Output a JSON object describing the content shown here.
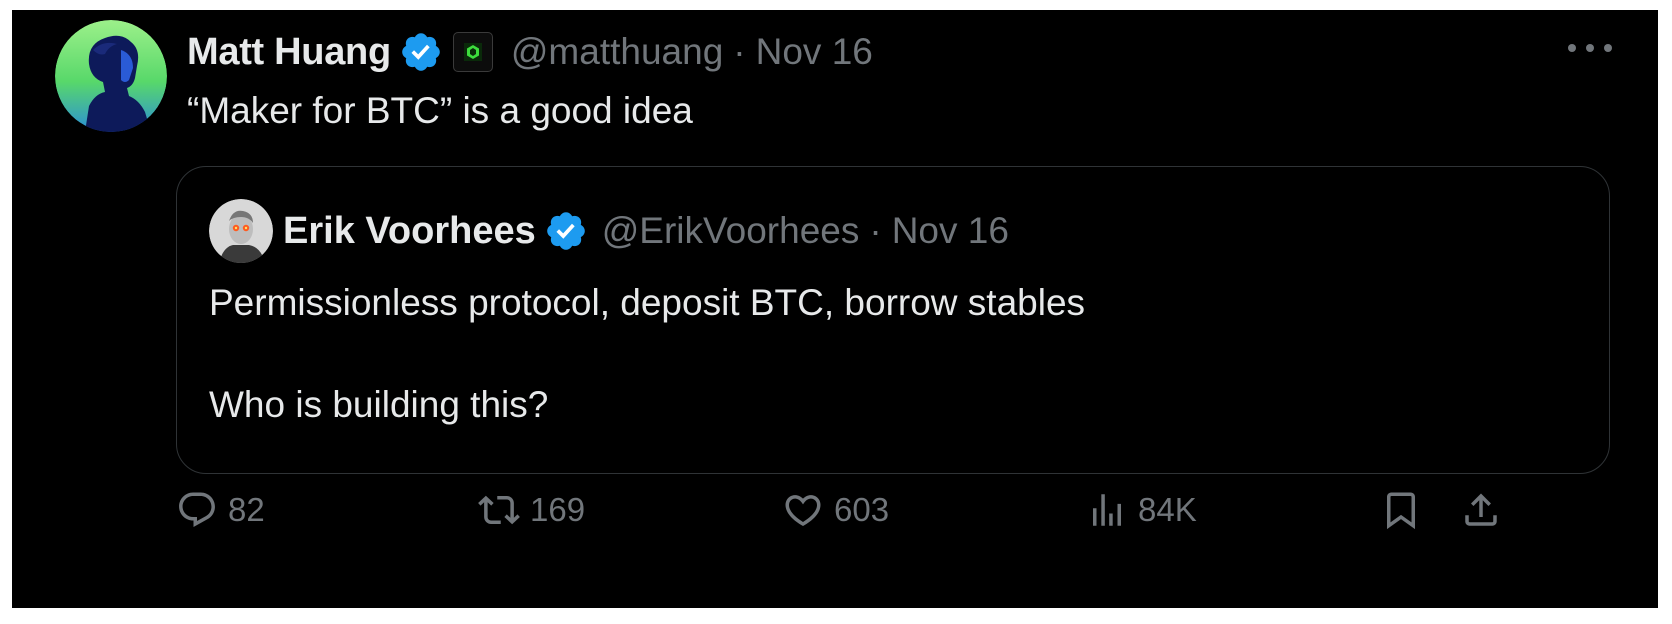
{
  "tweet": {
    "author": {
      "name": "Matt Huang",
      "handle": "@matthuang",
      "verified_icon": "verified-badge-icon",
      "affiliate_icon": "paradigm-affiliate-badge-icon",
      "avatar": "avatar-profile-illustration"
    },
    "separator": "·",
    "date": "Nov 16",
    "text": "“Maker for BTC” is a good idea",
    "more_icon": "more-options-icon"
  },
  "quoted_tweet": {
    "author": {
      "name": "Erik Voorhees",
      "handle": "@ErikVoorhees",
      "verified_icon": "verified-badge-icon",
      "avatar": "avatar-photo-laser-eyes"
    },
    "separator": "·",
    "date": "Nov 16",
    "text": "Permissionless protocol, deposit BTC, borrow stables\n\nWho is building this?"
  },
  "actions": {
    "replies": {
      "icon": "reply-icon",
      "count": "82"
    },
    "reposts": {
      "icon": "repost-icon",
      "count": "169"
    },
    "likes": {
      "icon": "like-icon",
      "count": "603"
    },
    "views": {
      "icon": "views-icon",
      "count": "84K"
    },
    "bookmark": {
      "icon": "bookmark-icon"
    },
    "share": {
      "icon": "share-icon"
    }
  },
  "colors": {
    "background": "#000000",
    "text_primary": "#e7e9ea",
    "text_secondary": "#71767b",
    "verified_blue": "#1d9bf0",
    "border": "#2f3336"
  }
}
